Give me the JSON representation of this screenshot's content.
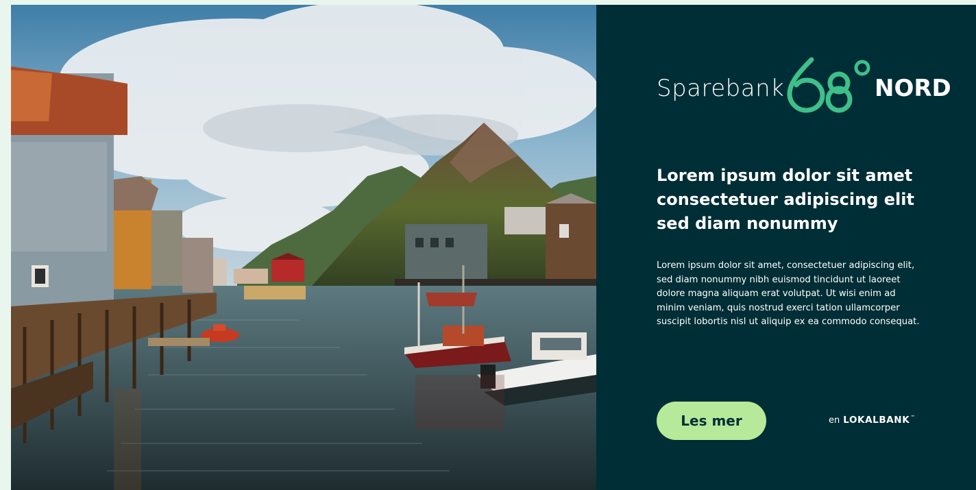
{
  "photo": {
    "alt_icon": "harbor-landscape-photo"
  },
  "logo": {
    "word": "Sparebank",
    "number": "68°",
    "suffix": "NORD"
  },
  "headline": "Lorem ipsum dolor sit amet consectetuer adipiscing elit sed diam nonummy",
  "body": "Lorem ipsum dolor sit amet, consectetuer adipiscing elit, sed diam nonummy nibh euismod tincidunt ut laoreet dolore magna aliquam erat volutpat. Ut wisi enim ad minim veniam, quis nostrud exerci tation ullamcorper suscipit lobortis nisl ut aliquip ex ea commodo consequat.",
  "cta_label": "Les mer",
  "tagline": {
    "prefix": "en",
    "brand": "LOKALBANK",
    "tm": "™"
  },
  "colors": {
    "page_bg": "#e9f6ee",
    "panel_bg": "#002e36",
    "accent_green": "#3fbf8a",
    "cta_bg": "#b7e99a",
    "text": "#ffffff"
  }
}
